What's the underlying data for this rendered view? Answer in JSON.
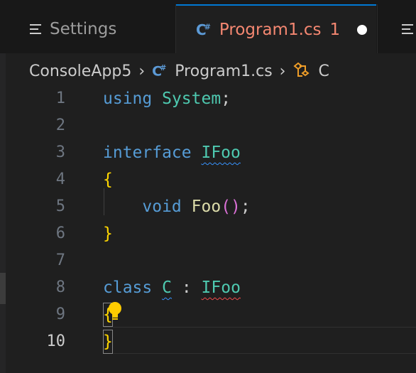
{
  "tabs": [
    {
      "label": "Settings",
      "icon": "settings-lines-icon",
      "active": false
    },
    {
      "label": "Program1.cs",
      "icon": "csharp-file-icon",
      "problems": "1",
      "modified": true,
      "active": true
    },
    {
      "label": "",
      "icon": "settings-lines-icon",
      "active": false
    }
  ],
  "breadcrumb": {
    "project": "ConsoleApp5",
    "file": "Program1.cs",
    "symbol": "C"
  },
  "editor": {
    "line_numbers": [
      "1",
      "2",
      "3",
      "4",
      "5",
      "6",
      "7",
      "8",
      "9",
      "10"
    ],
    "active_line": "10",
    "lines": {
      "l1": {
        "kw": "using",
        "ns": "System",
        "punct": ";"
      },
      "l3": {
        "kw": "interface",
        "name": "IFoo"
      },
      "l4": {
        "brace": "{"
      },
      "l5": {
        "kw": "void",
        "fn": "Foo",
        "open": "(",
        "close": ")",
        "punct": ";"
      },
      "l6": {
        "brace": "}"
      },
      "l8": {
        "kw": "class",
        "name": "C",
        "colon": ":",
        "base": "IFoo"
      },
      "l9": {
        "brace": "{"
      },
      "l10": {
        "brace": "}"
      }
    }
  },
  "colors": {
    "tab_accent": "#0078d4",
    "modified_tab_text": "#f48771",
    "keyword": "#569cd6",
    "type": "#4ec9b0",
    "function": "#dcdcaa",
    "bracket_level1": "#ffd700",
    "bracket_level2": "#da70d6",
    "warning_squiggle": "#3794ff",
    "error_squiggle": "#f14c4c",
    "lightbulb": "#ffcc00"
  }
}
